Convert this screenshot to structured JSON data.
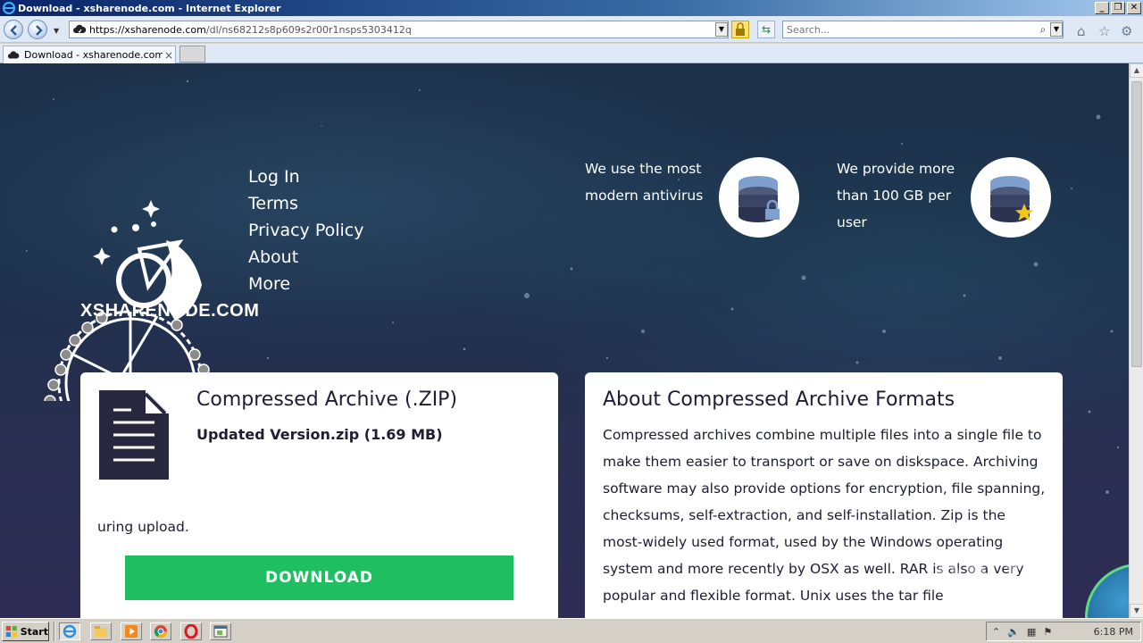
{
  "window": {
    "title": "Download - xsharenode.com - Internet Explorer",
    "controls": {
      "minimize": "_",
      "restore": "❐",
      "close": "✕"
    }
  },
  "address_bar": {
    "url_main": "https://xsharenode.com",
    "url_path": "/dl/ns68212s8p609s2r00r1nsps5303412q",
    "dropdown": "▼"
  },
  "search": {
    "placeholder": "Search...",
    "icon": "search-icon"
  },
  "toolbar_icons": {
    "home": "⌂",
    "favorites": "☆",
    "settings": "⚙"
  },
  "tabs": [
    {
      "label": "Download - xsharenode.com",
      "close": "×"
    }
  ],
  "page": {
    "brand": "XSHARENODE.COM",
    "menu": [
      "Log In",
      "Terms",
      "Privacy Policy",
      "About",
      "More"
    ],
    "features": [
      {
        "text": "We use the most modern antivirus",
        "icon": "database-lock-icon"
      },
      {
        "text": "We provide more than 100 GB per user",
        "icon": "database-star-icon"
      }
    ],
    "file_card": {
      "type": "Compressed Archive (.ZIP)",
      "name": "Updated Version.zip (1.69 MB)",
      "note": "uring upload.",
      "download_label": "DOWNLOAD"
    },
    "about_card": {
      "title": "About Compressed Archive Formats",
      "body": "Compressed archives combine multiple files into a single file to make them easier to transport or save on diskspace. Archiving software may also provide options for encryption, file spanning, checksums, self-extraction, and self-installation. Zip is the most-widely used format, used by the Windows operating system and more recently by OSX as well. RAR is also a very popular and flexible format. Unix uses the tar file"
    },
    "watermark": "ANY RUN"
  },
  "taskbar": {
    "start_label": "Start",
    "quick_launch": [
      "ie-icon",
      "folder-icon",
      "media-player-icon",
      "chrome-icon",
      "opera-icon",
      "window-icon"
    ],
    "clock": "6:18 PM"
  },
  "colors": {
    "download_button": "#1fbe61",
    "page_background": "#1d3049",
    "card_text": "#1d1d33"
  }
}
